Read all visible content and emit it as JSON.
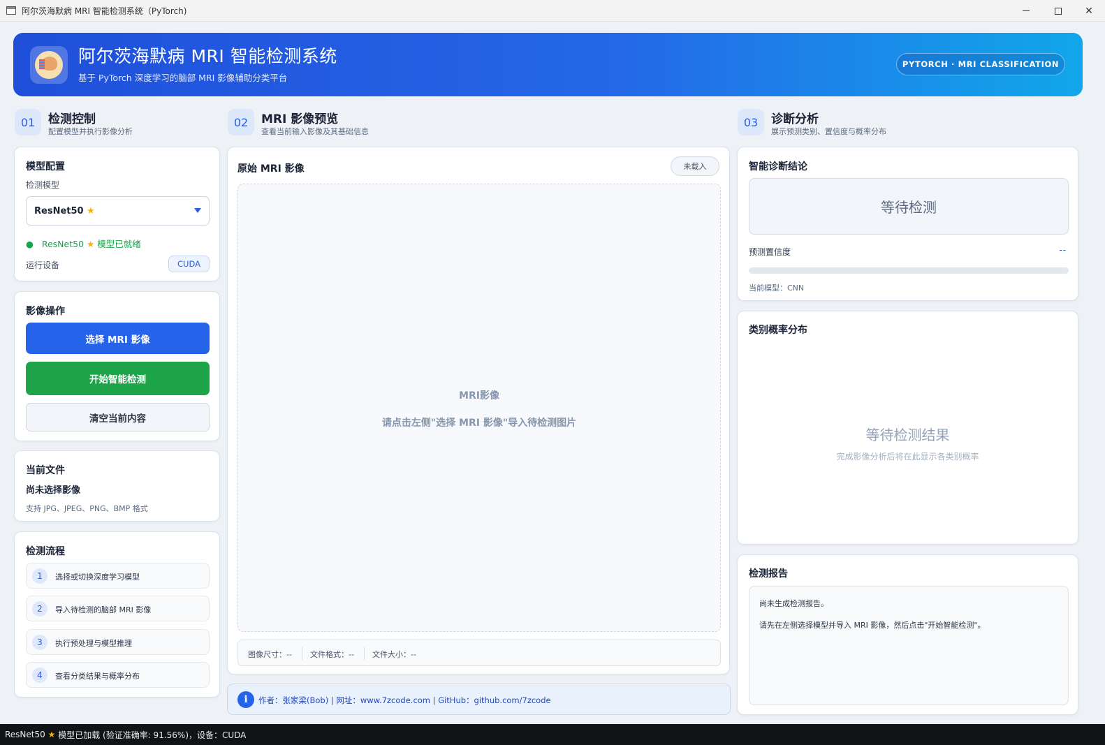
{
  "window": {
    "title": "阿尔茨海默病 MRI 智能检测系统（PyTorch)"
  },
  "banner": {
    "title": "阿尔茨海默病 MRI 智能检测系统",
    "subtitle": "基于 PyTorch 深度学习的脑部 MRI 影像辅助分类平台",
    "badge": "PYTORCH · MRI CLASSIFICATION"
  },
  "sections": {
    "control": {
      "num": "01",
      "title": "检测控制",
      "sub": "配置模型并执行影像分析"
    },
    "preview": {
      "num": "02",
      "title": "MRI 影像预览",
      "sub": "查看当前输入影像及其基础信息"
    },
    "diagnosis": {
      "num": "03",
      "title": "诊断分析",
      "sub": "展示预测类别、置信度与概率分布"
    }
  },
  "model_card": {
    "title": "模型配置",
    "model_label": "检测模型",
    "selected_model": "ResNet50",
    "ready_model": "ResNet50",
    "ready_text": "模型已就绪",
    "device_label": "运行设备",
    "device": "CUDA",
    "star_icon": "star-icon"
  },
  "ops_card": {
    "title": "影像操作",
    "select_btn": "选择 MRI 影像",
    "detect_btn": "开始智能检测",
    "clear_btn": "清空当前内容"
  },
  "file_card": {
    "title": "当前文件",
    "name": "尚未选择影像",
    "hint": "支持 JPG、JPEG、PNG、BMP 格式"
  },
  "flow_card": {
    "title": "检测流程",
    "steps": [
      {
        "num": "1",
        "text": "选择或切换深度学习模型"
      },
      {
        "num": "2",
        "text": "导入待检测的脑部 MRI 影像"
      },
      {
        "num": "3",
        "text": "执行预处理与模型推理"
      },
      {
        "num": "4",
        "text": "查看分类结果与概率分布"
      }
    ]
  },
  "preview_card": {
    "title": "原始 MRI 影像",
    "status": "未载入",
    "placeholder_title": "MRI影像",
    "placeholder_hint": "请点击左侧\"选择 MRI 影像\"导入待检测图片",
    "size_label": "图像尺寸：--",
    "format_label": "文件格式：--",
    "filesize_label": "文件大小：--"
  },
  "author": {
    "text": "作者：张家梁(Bob) | 网址：www.7zcode.com | GitHub：github.com/7zcode"
  },
  "diagnosis_card": {
    "title": "智能诊断结论",
    "result": "等待检测",
    "confidence_label": "预测置信度",
    "confidence_value": "--",
    "confidence_fraction": 0,
    "current_model": "当前模型：CNN"
  },
  "prob_card": {
    "title": "类别概率分布",
    "wait_title": "等待检测结果",
    "wait_sub": "完成影像分析后将在此显示各类别概率"
  },
  "report_card": {
    "title": "检测报告",
    "line1": "尚未生成检测报告。",
    "line2": "请先在左侧选择模型并导入 MRI 影像，然后点击\"开始智能检测\"。"
  },
  "statusbar": {
    "model": "ResNet50",
    "text": "模型已加载 (验证准确率: 91.56%)，设备：CUDA"
  },
  "colors": {
    "primary": "#2563eb",
    "success": "#1ea54a",
    "banner_start": "#1f4fd9",
    "banner_end": "#11a7ea"
  }
}
